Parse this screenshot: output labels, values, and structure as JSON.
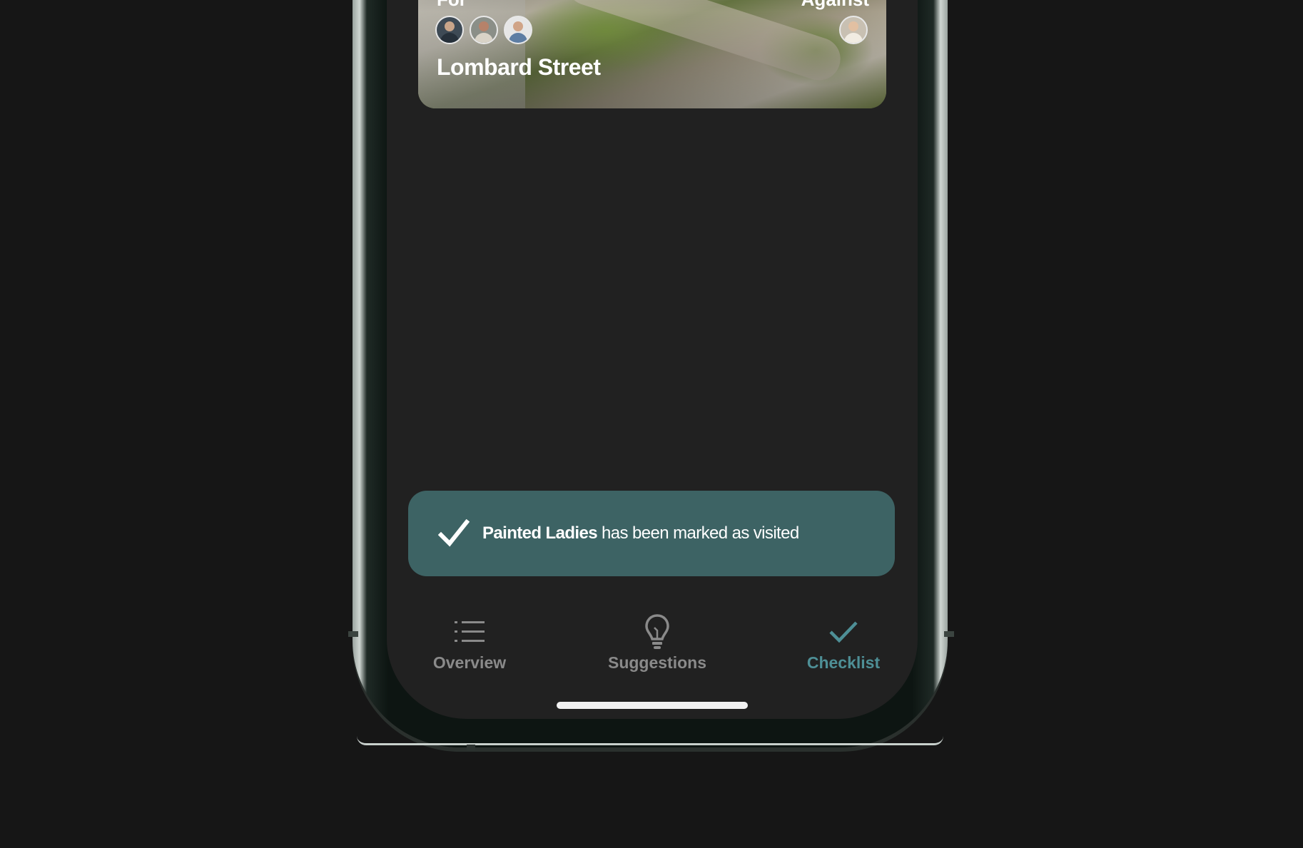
{
  "card": {
    "for_label": "For",
    "against_label": "Against",
    "title": "Lombard Street",
    "for_avatars": [
      "avatar",
      "avatar",
      "avatar"
    ],
    "against_avatars": [
      "avatar"
    ]
  },
  "toast": {
    "icon": "checkmark-icon",
    "bold_text": "Painted Ladies",
    "text": " has been marked as visited",
    "background": "#3d6364"
  },
  "tab_bar": {
    "tabs": [
      {
        "label": "Overview",
        "icon": "list-icon",
        "active": false
      },
      {
        "label": "Suggestions",
        "icon": "lightbulb-icon",
        "active": false
      },
      {
        "label": "Checklist",
        "icon": "checkmark-icon",
        "active": true
      }
    ],
    "active_color": "#4e8f96",
    "inactive_color": "#8a8a8a"
  },
  "colors": {
    "background": "#161616",
    "screen": "#212121"
  }
}
